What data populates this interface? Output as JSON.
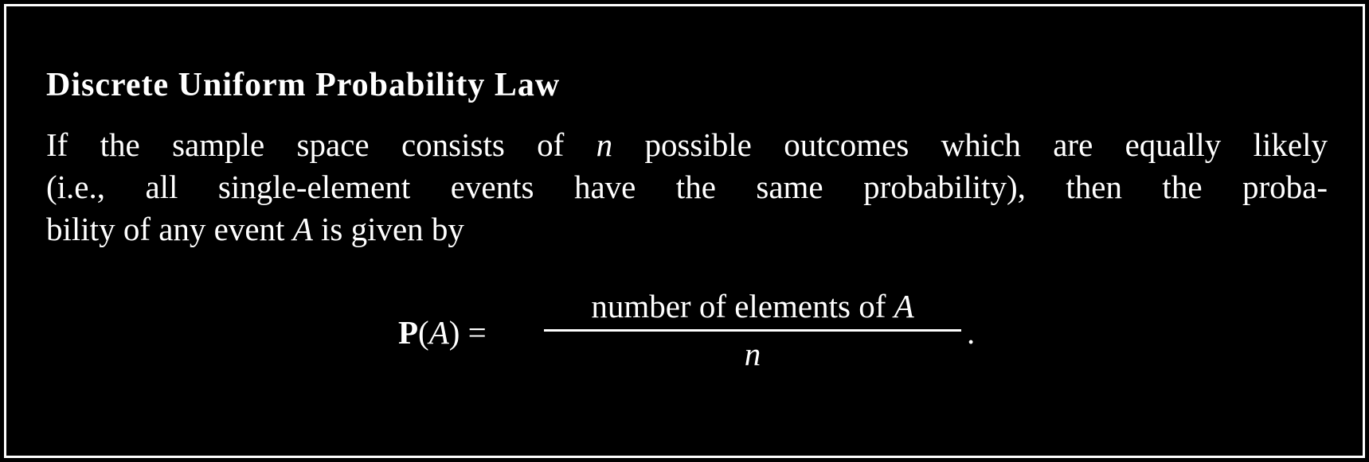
{
  "title": "Discrete Uniform Probability Law",
  "paragraph": {
    "line1_a": "If the sample space consists of ",
    "line1_var": "n",
    "line1_b": " possible outcomes which are equally likely",
    "line2": "(i.e., all single-element events have the same probability), then the proba-",
    "line3_a": "bility of any event ",
    "line3_var": "A",
    "line3_b": " is given by"
  },
  "formula": {
    "lhs_prob": "P",
    "lhs_open": "(",
    "lhs_var": "A",
    "lhs_close": ")",
    "equals": " = ",
    "numerator_text": "number of elements of ",
    "numerator_var": "A",
    "denominator": "n",
    "end": "."
  },
  "colors": {
    "background": "#000000",
    "text": "#ffffff",
    "border": "#ffffff"
  }
}
